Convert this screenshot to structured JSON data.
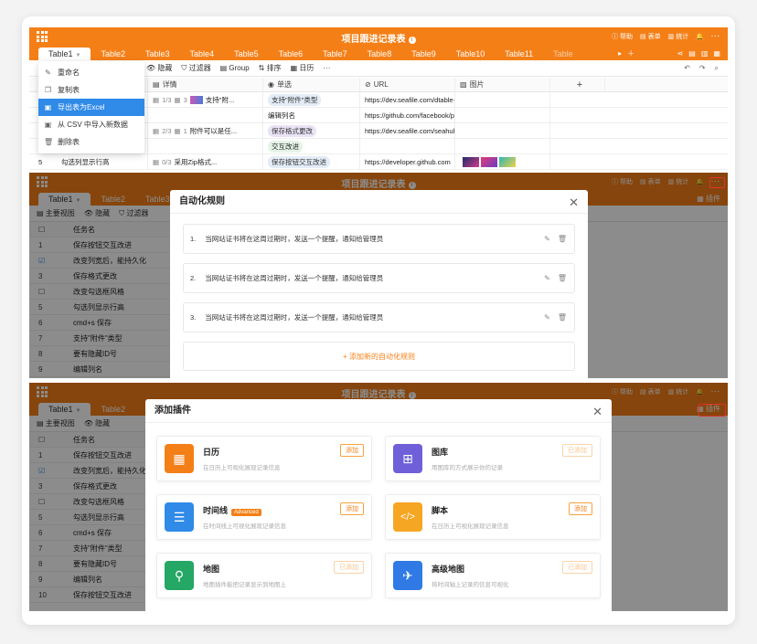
{
  "app": {
    "title": "项目跟进记录表",
    "help": "帮助",
    "form": "表单",
    "stats": "统计",
    "plugins": "插件"
  },
  "tabs": [
    "Table1",
    "Table2",
    "Table3",
    "Table4",
    "Table5",
    "Table6",
    "Table7",
    "Table8",
    "Table9",
    "Table10",
    "Table11",
    "Table"
  ],
  "toolbar": {
    "main_view": "主要视图",
    "hide": "隐藏",
    "filter": "过滤器",
    "group": "Group",
    "sort": "排序",
    "calendar": "日历",
    "more": "···"
  },
  "columns": {
    "details": "详情",
    "single_select": "单选",
    "url": "URL",
    "image": "图片",
    "task": "任务名"
  },
  "context_menu": [
    "重命名",
    "复制表",
    "导出表为Excel",
    "从 CSV 中导入新数据",
    "删除表"
  ],
  "rows": [
    {
      "no": "1",
      "name": "保存按钮交互改进"
    },
    {
      "no": "2",
      "name": "改变列宽后，能持久化"
    },
    {
      "no": "3",
      "name": "保存格式更改"
    },
    {
      "no": "4",
      "name": "改变勾选框风格"
    },
    {
      "no": "5",
      "name": "勾选列显示行高"
    },
    {
      "no": "6",
      "name": "cmd+s 保存"
    },
    {
      "no": "7",
      "name": "支持\"附件\"类型"
    },
    {
      "no": "8",
      "name": "要有隐藏ID号"
    },
    {
      "no": "9",
      "name": "编辑列名"
    },
    {
      "no": "10",
      "name": "保存按钮交互改进"
    }
  ],
  "panel1_rows": [
    {
      "details": "1/3",
      "attach": "3",
      "desc": "支持\"附...",
      "select": "支持\"附件\"类型",
      "url": "https://dev.seafile.com/dtable-"
    },
    {
      "details": "",
      "attach": "",
      "desc": "",
      "select": "编辑列名",
      "url": "https://github.com/facebook/p"
    },
    {
      "details": "2/3",
      "attach": "1",
      "desc": "附件可以是任...",
      "select": "保存格式更改",
      "url": "https://dev.seafile.com/seahub"
    },
    {
      "details": "",
      "attach": "",
      "desc": "",
      "select": "交互改进",
      "url": ""
    },
    {
      "details": "0/3",
      "attach": "",
      "desc": "采用Zip格式...",
      "select": "保存按钮交互改进",
      "url": "https://developer.github.com",
      "no": "5",
      "name": "勾选列显示行高"
    }
  ],
  "automation": {
    "title": "自动化规则",
    "rules": [
      {
        "num": "1.",
        "text": "当网站证书将在这周过期时，发送一个提醒，通知给管理员"
      },
      {
        "num": "2.",
        "text": "当网站证书将在这周过期时，发送一个提醒，通知给管理员"
      },
      {
        "num": "3.",
        "text": "当网站证书将在这周过期时，发送一个提醒，通知给管理员"
      }
    ],
    "add": "+ 添加新的自动化规则"
  },
  "plugins": {
    "title": "添加插件",
    "items": [
      {
        "name": "日历",
        "desc": "在日历上可视化展现记录信息",
        "btn": "添加",
        "color": "#f57f17",
        "icon": "calendar-icon",
        "glyph": "▦",
        "added": false
      },
      {
        "name": "图库",
        "desc": "用图库的方式展示你的记录",
        "btn": "已添加",
        "color": "#6f5fd8",
        "icon": "gallery-icon",
        "glyph": "⊞",
        "added": true
      },
      {
        "name": "时间线",
        "tag": "Advanced",
        "desc": "在时间线上可视化展现记录信息",
        "btn": "添加",
        "color": "#2f8ae8",
        "icon": "timeline-icon",
        "glyph": "☰",
        "added": false
      },
      {
        "name": "脚本",
        "desc": "在日历上可视化展现记录信息",
        "btn": "添加",
        "color": "#f5a623",
        "icon": "script-icon",
        "glyph": "</>",
        "added": false
      },
      {
        "name": "地图",
        "desc": "地图插件能把记录显示到地图上",
        "btn": "已添加",
        "color": "#25a765",
        "icon": "map-icon",
        "glyph": "⚲",
        "added": true
      },
      {
        "name": "高级地图",
        "desc": "将时间轴上记录的信息可视化",
        "btn": "已添加",
        "color": "#2f7ae5",
        "icon": "advanced-map-icon",
        "glyph": "✈",
        "added": true
      }
    ]
  }
}
